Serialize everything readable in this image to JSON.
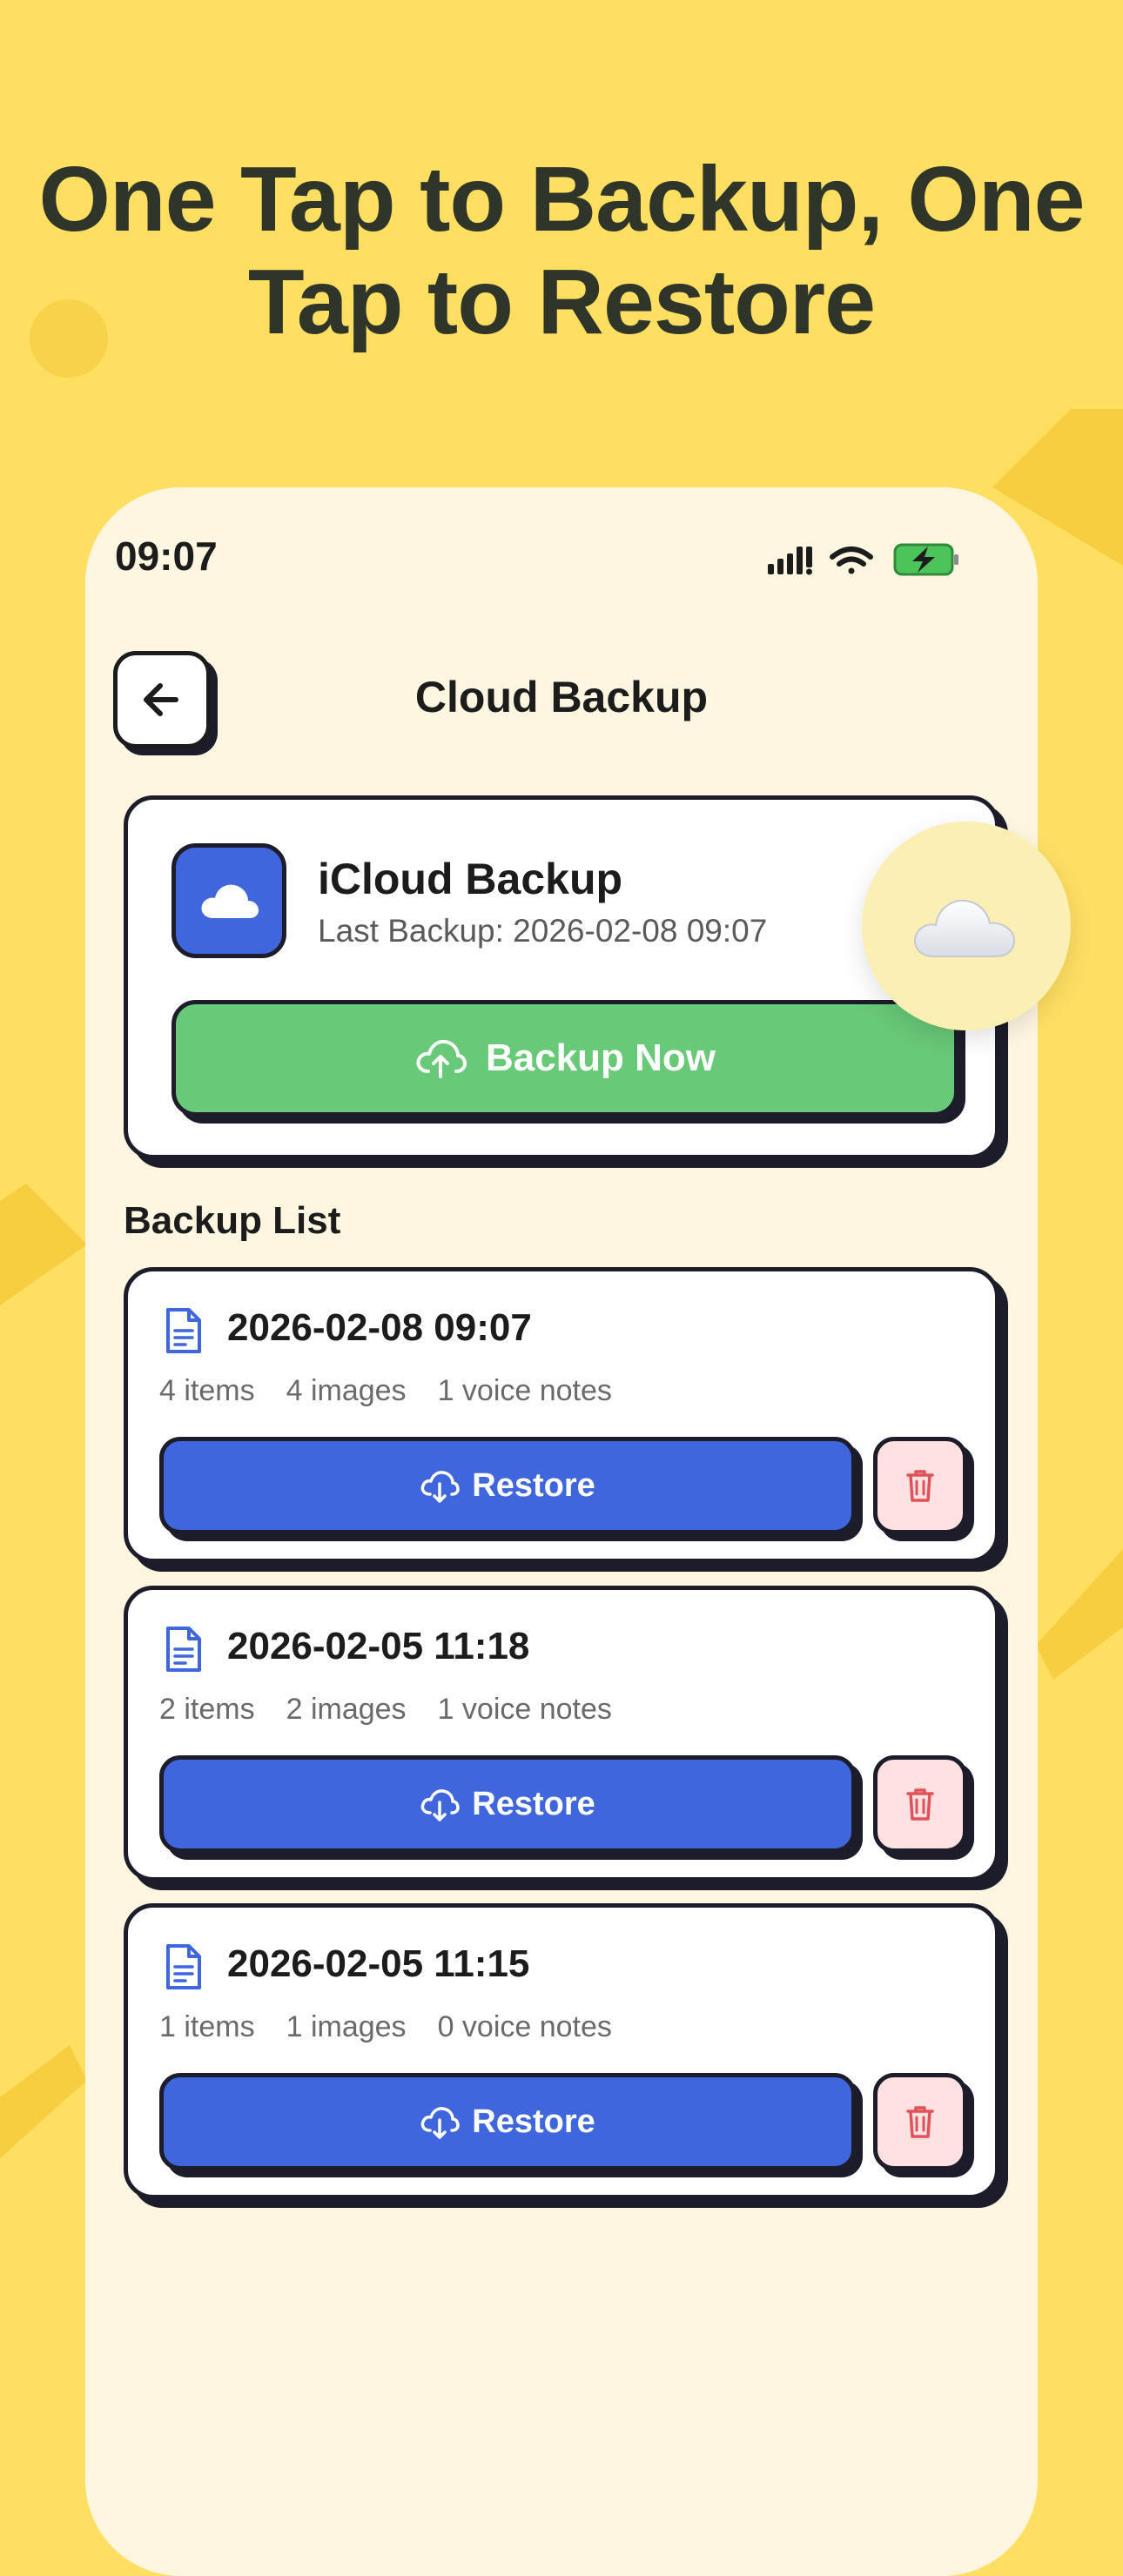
{
  "hero": {
    "title_line1": "One Tap to Backup, One",
    "title_line2": "Tap to Restore"
  },
  "status_bar": {
    "time": "09:07",
    "icons": [
      "signal-icon",
      "wifi-icon",
      "battery-charging-icon"
    ]
  },
  "nav": {
    "back_icon": "arrow-left-icon",
    "title": "Cloud Backup"
  },
  "cloud_card": {
    "icon": "cloud-icon",
    "title": "iCloud Backup",
    "last_backup": "Last Backup: 2026-02-08 09:07",
    "button_label": "Backup Now",
    "button_icon": "cloud-upload-icon"
  },
  "backup_list": {
    "title": "Backup List",
    "items": [
      {
        "date": "2026-02-08 09:07",
        "items": "4 items",
        "images": "4 images",
        "voice": "1 voice notes",
        "restore_label": "Restore"
      },
      {
        "date": "2026-02-05 11:18",
        "items": "2 items",
        "images": "2 images",
        "voice": "1 voice notes",
        "restore_label": "Restore"
      },
      {
        "date": "2026-02-05 11:15",
        "items": "1 items",
        "images": "1 images",
        "voice": "0 voice notes",
        "restore_label": "Restore"
      }
    ]
  },
  "colors": {
    "background": "#FFDF62",
    "phone": "#FFF6E2",
    "primary_blue": "#3F66DD",
    "success_green": "#68C978",
    "delete_pink": "#FFE1E1",
    "delete_red": "#E0525A",
    "outline": "#1c1c2a"
  }
}
